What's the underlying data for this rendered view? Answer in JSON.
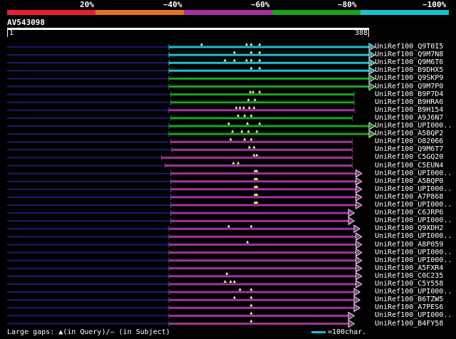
{
  "legend": {
    "labels": [
      "20%",
      "~40%",
      "~60%",
      "~80%",
      "~100%"
    ],
    "colors": [
      "#e8202e",
      "#e9731b",
      "#a2339c",
      "#1aa31c",
      "#19c2cc"
    ]
  },
  "query": {
    "name": "AV543098",
    "start": "1",
    "end": "388",
    "length": 388
  },
  "hits": [
    {
      "label": "UniRef100_Q9T0I5",
      "ci": 4,
      "s": 174,
      "e": 388,
      "cap": "tri",
      "gaps": [
        209,
        257,
        262,
        271
      ]
    },
    {
      "label": "UniRef100_Q9M7N8",
      "ci": 4,
      "s": 174,
      "e": 388,
      "cap": "tri",
      "gaps": [
        244,
        262,
        271
      ]
    },
    {
      "label": "UniRef100_Q9M6T6",
      "ci": 4,
      "s": 174,
      "e": 388,
      "cap": "tri",
      "gaps": [
        234,
        244,
        257,
        262,
        271
      ]
    },
    {
      "label": "UniRef100_B9DHX5",
      "ci": 4,
      "s": 174,
      "e": 388,
      "cap": "tri",
      "gaps": [
        262,
        271
      ]
    },
    {
      "label": "UniRef100_Q9SKP9",
      "ci": 3,
      "s": 174,
      "e": 388,
      "cap": "tri",
      "gaps": []
    },
    {
      "label": "UniRef100_Q9M7P0",
      "ci": 3,
      "s": 174,
      "e": 388,
      "cap": "tri",
      "gaps": []
    },
    {
      "label": "UniRef100_B9P7D4",
      "ci": 3,
      "s": 176,
      "e": 372,
      "cap": "bar",
      "gaps": [
        261,
        264,
        271
      ]
    },
    {
      "label": "UniRef100_B9HRA6",
      "ci": 3,
      "s": 176,
      "e": 372,
      "cap": "bar",
      "gaps": [
        259,
        266
      ]
    },
    {
      "label": "UniRef100_B9H154",
      "ci": 2,
      "s": 174,
      "e": 372,
      "cap": "bar",
      "gaps": [
        246,
        250,
        254,
        260,
        265
      ]
    },
    {
      "label": "UniRef100_A9J6N7",
      "ci": 3,
      "s": 176,
      "e": 370,
      "cap": "bar",
      "gaps": [
        248,
        255,
        262
      ]
    },
    {
      "label": "UniRef100_UPI000..",
      "ci": 3,
      "s": 174,
      "e": 388,
      "cap": "tri",
      "gaps": [
        238,
        258,
        271
      ]
    },
    {
      "label": "UniRef100_A5BQP2",
      "ci": 3,
      "s": 174,
      "e": 388,
      "cap": "tri",
      "gaps": [
        242,
        252,
        259,
        268
      ]
    },
    {
      "label": "UniRef100_O82066",
      "ci": 2,
      "s": 176,
      "e": 370,
      "cap": "bar",
      "gaps": [
        240,
        255,
        262
      ]
    },
    {
      "label": "UniRef100_Q9M6T7",
      "ci": 2,
      "s": 177,
      "e": 370,
      "cap": "bar",
      "gaps": [
        260,
        265
      ]
    },
    {
      "label": "UniRef100_C5GQ20",
      "ci": 2,
      "s": 166,
      "e": 370,
      "cap": "bar",
      "gaps": [
        265,
        268
      ]
    },
    {
      "label": "UniRef100_C5EUN4",
      "ci": 2,
      "s": 170,
      "e": 370,
      "cap": "bar",
      "gaps": [
        243,
        248
      ]
    },
    {
      "label": "UniRef100_UPI000..",
      "ci": 2,
      "s": 176,
      "e": 374,
      "cap": "tri",
      "gaps": [
        266,
        268
      ]
    },
    {
      "label": "UniRef100_A5BQP0",
      "ci": 2,
      "s": 176,
      "e": 374,
      "cap": "tri",
      "gaps": [
        266,
        268
      ]
    },
    {
      "label": "UniRef100_UPI000..",
      "ci": 2,
      "s": 176,
      "e": 374,
      "cap": "tri",
      "gaps": [
        266,
        268
      ]
    },
    {
      "label": "UniRef100_A7P868",
      "ci": 2,
      "s": 176,
      "e": 374,
      "cap": "tri",
      "gaps": [
        266,
        268
      ]
    },
    {
      "label": "UniRef100_UPI000..",
      "ci": 2,
      "s": 176,
      "e": 374,
      "cap": "tri",
      "gaps": [
        266,
        268
      ]
    },
    {
      "label": "UniRef100_C6JRP6",
      "ci": 2,
      "s": 176,
      "e": 366,
      "cap": "tri",
      "gaps": []
    },
    {
      "label": "UniRef100_UPI000..",
      "ci": 2,
      "s": 176,
      "e": 366,
      "cap": "tri",
      "gaps": []
    },
    {
      "label": "UniRef100_Q9XDH2",
      "ci": 2,
      "s": 174,
      "e": 372,
      "cap": "tri",
      "gaps": [
        238,
        262
      ]
    },
    {
      "label": "UniRef100_UPI000..",
      "ci": 2,
      "s": 174,
      "e": 374,
      "cap": "tri",
      "gaps": []
    },
    {
      "label": "UniRef100_A8P059",
      "ci": 2,
      "s": 174,
      "e": 374,
      "cap": "tri",
      "gaps": [
        258
      ]
    },
    {
      "label": "UniRef100_UPI000..",
      "ci": 2,
      "s": 174,
      "e": 374,
      "cap": "tri",
      "gaps": []
    },
    {
      "label": "UniRef100_UPI000..",
      "ci": 2,
      "s": 174,
      "e": 374,
      "cap": "tri",
      "gaps": []
    },
    {
      "label": "UniRef100_A5FXR4",
      "ci": 2,
      "s": 174,
      "e": 374,
      "cap": "tri",
      "gaps": []
    },
    {
      "label": "UniRef100_C0C235",
      "ci": 2,
      "s": 174,
      "e": 374,
      "cap": "tri",
      "gaps": [
        236
      ]
    },
    {
      "label": "UniRef100_C5Y558",
      "ci": 2,
      "s": 174,
      "e": 374,
      "cap": "tri",
      "gaps": [
        234,
        240,
        244
      ]
    },
    {
      "label": "UniRef100_UPI000..",
      "ci": 2,
      "s": 174,
      "e": 372,
      "cap": "tri",
      "gaps": [
        250,
        262
      ]
    },
    {
      "label": "UniRef100_B6TZW5",
      "ci": 2,
      "s": 174,
      "e": 372,
      "cap": "tri",
      "gaps": [
        244,
        262
      ]
    },
    {
      "label": "UniRef100_A7PES6",
      "ci": 2,
      "s": 174,
      "e": 372,
      "cap": "tri",
      "gaps": [
        262
      ]
    },
    {
      "label": "UniRef100_UPI000..",
      "ci": 2,
      "s": 174,
      "e": 366,
      "cap": "tri",
      "gaps": [
        262
      ]
    },
    {
      "label": "UniRef100_B4FY58",
      "ci": 2,
      "s": 174,
      "e": 366,
      "cap": "tri",
      "gaps": [
        262
      ]
    }
  ],
  "footer": {
    "gaps_label": "Large gaps: ▲(in Query)/— (in Subject)",
    "scale_label": "=100char."
  }
}
